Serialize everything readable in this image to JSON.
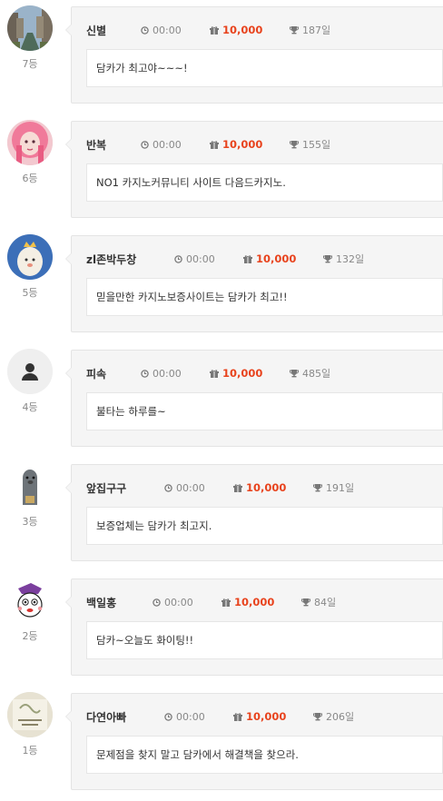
{
  "entries": [
    {
      "name": "신별",
      "time": "00:00",
      "points": "10,000",
      "days": "187일",
      "rank": "7등",
      "message": "담카가 최고야~~~!",
      "avatar": "city-canal-photo"
    },
    {
      "name": "반복",
      "time": "00:00",
      "points": "10,000",
      "days": "155일",
      "rank": "6등",
      "message": "NO1 카지노커뮤니티 사이트 다음드카지노.",
      "avatar": "pink-hair-portrait"
    },
    {
      "name": "zl존박두창",
      "time": "00:00",
      "points": "10,000",
      "days": "132일",
      "rank": "5등",
      "message": "믿을만한 카지노보증사이트는 담카가 최고!!",
      "avatar": "egg-character"
    },
    {
      "name": "피속",
      "time": "00:00",
      "points": "10,000",
      "days": "485일",
      "rank": "4등",
      "message": "불타는 하루를~",
      "avatar": "default-user"
    },
    {
      "name": "앞집구구",
      "time": "00:00",
      "points": "10,000",
      "days": "191일",
      "rank": "3등",
      "message": "보증업체는 담카가 최고지.",
      "avatar": "seal-character"
    },
    {
      "name": "백일홍",
      "time": "00:00",
      "points": "10,000",
      "days": "84일",
      "rank": "2등",
      "message": "담카~오늘도 화이팅!!",
      "avatar": "cartoon-face"
    },
    {
      "name": "다연아빠",
      "time": "00:00",
      "points": "10,000",
      "days": "206일",
      "rank": "1등",
      "message": "문제점을 찾지 말고 담카에서 해결책을 찾으라.",
      "avatar": "drawing-photo"
    }
  ],
  "colors": {
    "points": "#e8431d",
    "card_bg": "#f5f5f5",
    "border": "#e4e4e4"
  }
}
